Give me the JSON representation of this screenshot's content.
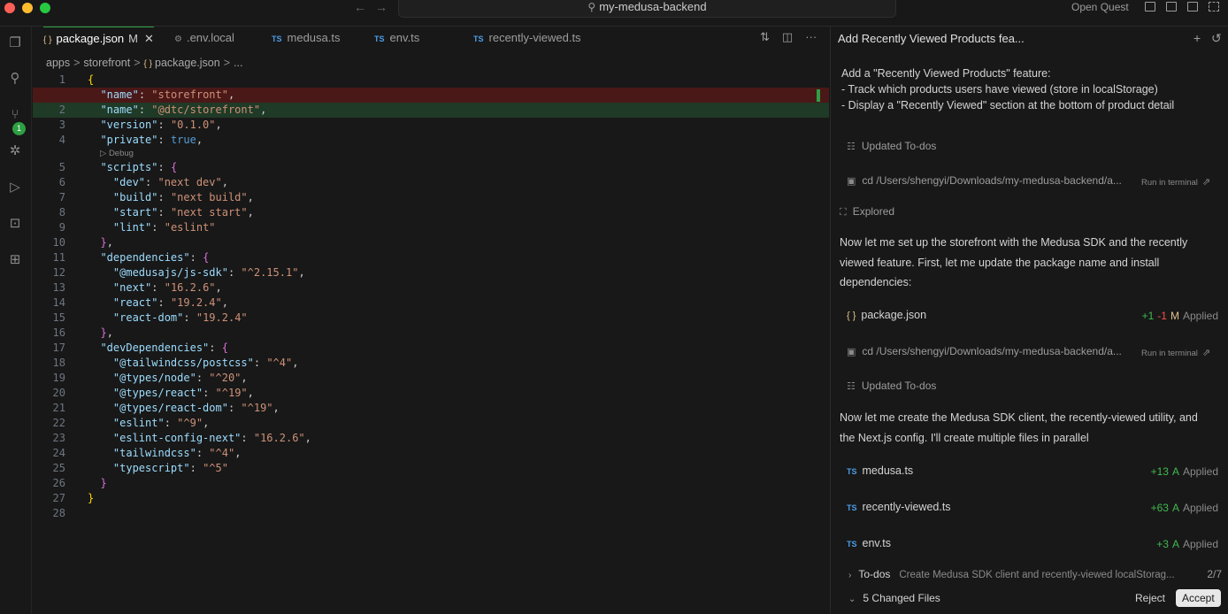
{
  "window": {
    "title": "my-medusa-backend",
    "open_quest": "Open Quest"
  },
  "activity": {
    "source_control_badge": "1"
  },
  "tabs": [
    {
      "label": "package.json",
      "modified": "M",
      "active": true
    },
    {
      "label": ".env.local"
    },
    {
      "label": "medusa.ts",
      "lang": "TS"
    },
    {
      "label": "env.ts",
      "lang": "TS"
    },
    {
      "label": "recently-viewed.ts",
      "lang": "TS"
    }
  ],
  "breadcrumb": {
    "a": "apps",
    "b": "storefront",
    "c": "package.json",
    "d": "..."
  },
  "editor": {
    "codelens": "▷ Debug",
    "line_numbers": [
      "1",
      "2",
      "3",
      "4",
      "5",
      "6",
      "7",
      "8",
      "9",
      "10",
      "11",
      "12",
      "13",
      "14",
      "15",
      "16",
      "17",
      "18",
      "19",
      "20",
      "21",
      "22",
      "23",
      "24",
      "25",
      "26",
      "27",
      "28"
    ]
  },
  "chat": {
    "title": "Add Recently Viewed Products fea...",
    "user_message": [
      "Add a \"Recently Viewed Products\" feature:",
      "- Track which products users have viewed (store in localStorage)",
      "- Display a \"Recently Viewed\" section at the bottom of product detail"
    ],
    "updated_todos": "Updated To-dos",
    "cmd": "cd /Users/shengyi/Downloads/my-medusa-backend/a...",
    "run_in_terminal": "Run in terminal",
    "explored": "Explored",
    "para1": "Now let me set up the storefront with the Medusa SDK and the recently viewed feature. First, let me update the package name and install dependencies:",
    "para2": "Now let me create the Medusa SDK client, the recently-viewed utility, and the Next.js config. I'll create multiple files in parallel",
    "files": [
      {
        "name": "package.json",
        "plus": "+1",
        "minus": "-1",
        "status": "M",
        "applied": "Applied"
      },
      {
        "name": "medusa.ts",
        "plus": "+13",
        "status": "A",
        "applied": "Applied"
      },
      {
        "name": "recently-viewed.ts",
        "plus": "+63",
        "status": "A",
        "applied": "Applied"
      },
      {
        "name": "env.ts",
        "plus": "+3",
        "status": "A",
        "applied": "Applied"
      }
    ],
    "todos_label": "To-dos",
    "todos_desc": "Create Medusa SDK client and recently-viewed localStorag...",
    "todos_count": "2/7",
    "changed_files": "5 Changed Files",
    "reject": "Reject",
    "accept": "Accept"
  }
}
